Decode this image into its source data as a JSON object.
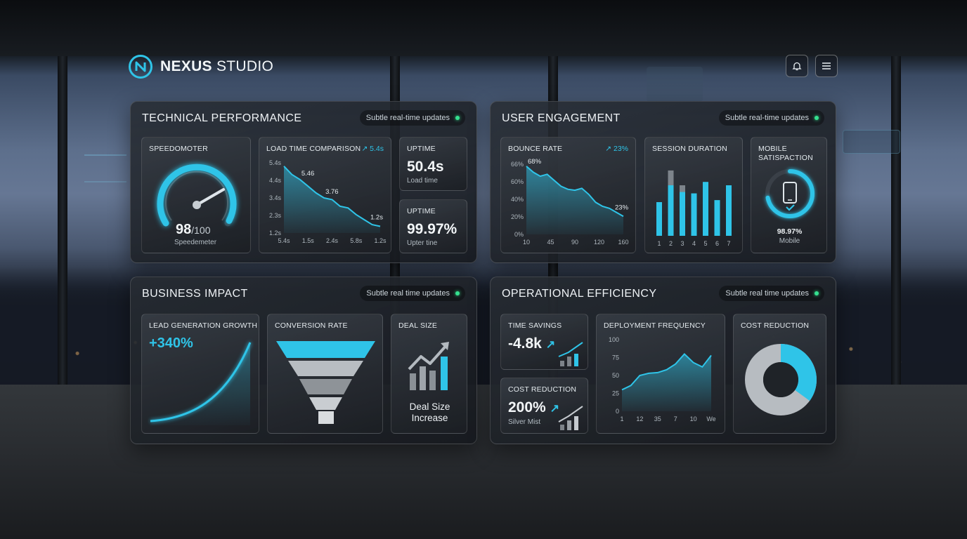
{
  "colors": {
    "accent": "#2fc4e8",
    "live_dot": "#35e08f",
    "panel": "#23272d"
  },
  "header": {
    "brand_bold": "NEXUS",
    "brand_rest": " STUDIO",
    "icons": [
      "bell-icon",
      "menu-icon"
    ]
  },
  "technical": {
    "title": "TECHNICAL PERFORMANCE",
    "status": "Subtle real-time updates",
    "speedometer": {
      "title": "SPEEDOMOTER",
      "value": "98",
      "max": "/100",
      "caption": "Speedemeter",
      "level": 0.98
    },
    "load_time": {
      "title": "LOAD TIME COMPARISON",
      "trend": "↗ 5.4s",
      "y_ticks": [
        "5.4s",
        "4.4s",
        "3.4s",
        "2.3s",
        "1.2s"
      ],
      "x_ticks": [
        "5.4s",
        "1.5s",
        "2.4s",
        "5.8s",
        "1.2s"
      ],
      "labels": [
        "5.46",
        "3.76",
        "1.2s"
      ],
      "values": [
        5.2,
        4.7,
        4.4,
        4.0,
        3.6,
        3.3,
        3.2,
        2.8,
        2.7,
        2.3,
        2.0,
        1.7,
        1.6
      ]
    },
    "uptime_load": {
      "title": "UPTIME",
      "value": "50.4s",
      "caption": "Load time"
    },
    "uptime": {
      "title": "UPTIME",
      "value": "99.97%",
      "caption": "Upter tine"
    }
  },
  "engagement": {
    "title": "USER ENGAGEMENT",
    "status": "Subtle real-time updates",
    "bounce": {
      "title": "BOUNCE RATE",
      "trend": "↗ 23%",
      "y_ticks": [
        "66%",
        "60%",
        "40%",
        "20%",
        "0%"
      ],
      "x_ticks": [
        "10",
        "45",
        "90",
        "120",
        "160"
      ],
      "labels": [
        "68%",
        "23%"
      ],
      "values": [
        68,
        62,
        58,
        60,
        54,
        48,
        45,
        44,
        46,
        40,
        32,
        28,
        26,
        22,
        18
      ]
    },
    "session": {
      "title": "SESSION DURATION",
      "x_ticks": [
        "1",
        "2",
        "3",
        "4",
        "5",
        "6",
        "7"
      ],
      "gray": [
        0.3,
        0.97,
        0.75,
        0.45,
        0.58,
        0.4,
        0.55
      ],
      "blue": [
        0.5,
        0.75,
        0.65,
        0.63,
        0.8,
        0.53,
        0.75
      ]
    },
    "mobile": {
      "title_line1": "MOBILE",
      "title_line2": "SATISPACTION",
      "value": "98.97%",
      "caption": "Mobile",
      "level": 0.99
    }
  },
  "business": {
    "title": "BUSINESS IMPACT",
    "status": "Subtle real time updates",
    "lead": {
      "title": "LEAD GENERATION GROWTH",
      "value": "+340%"
    },
    "conversion": {
      "title": "CONVERSION RATE"
    },
    "deal": {
      "title": "DEAL SIZE",
      "caption_line1": "Deal Size",
      "caption_line2": "Increase"
    }
  },
  "operations": {
    "title": "OPERATIONAL EFFICIENCY",
    "status": "Subtle real time updates",
    "time_savings": {
      "title": "TIME SAVINGS",
      "value": "-4.8k",
      "arrow": "↗"
    },
    "cost_small": {
      "title": "COST REDUCTION",
      "value": "200%",
      "arrow": "↗",
      "caption": "Silver Mist"
    },
    "deployment": {
      "title": "DEPLOYMENT FREQUENCY",
      "y_ticks": [
        "100",
        "75",
        "50",
        "25",
        "0"
      ],
      "x_ticks": [
        "1",
        "12",
        "35",
        "7",
        "10",
        "We"
      ],
      "values": [
        30,
        36,
        50,
        53,
        54,
        58,
        66,
        80,
        68,
        62,
        78
      ]
    },
    "cost_donut": {
      "title": "COST REDUCTION",
      "share": 0.35
    }
  }
}
